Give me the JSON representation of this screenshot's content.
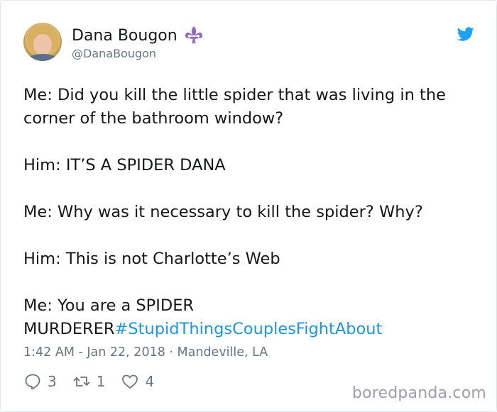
{
  "user": {
    "name": "Dana Bougon",
    "handle": "@DanaBougon"
  },
  "tweet": {
    "lines": [
      "Me: Did you kill the little spider that was living in the",
      "corner of the bathroom window?",
      "Him: IT’S A SPIDER DANA",
      "Me: Why was it necessary to kill the spider? Why?",
      "Him: This is not Charlotte’s Web",
      "Me: You are a SPIDER",
      "MURDERER",
      "#StupidThingsCouplesFightAbout"
    ],
    "meta": "1:42 AM - Jan 22, 2018 · Mandeville, LA"
  },
  "stats": {
    "replies": "3",
    "retweets": "1",
    "likes": "4"
  },
  "watermark": "boredpanda.com",
  "colors": {
    "text": "#14171a",
    "muted": "#657786",
    "link": "#1b95e0",
    "twitter_blue": "#1da1f2",
    "fleur_purple": "#8e6bbf"
  }
}
